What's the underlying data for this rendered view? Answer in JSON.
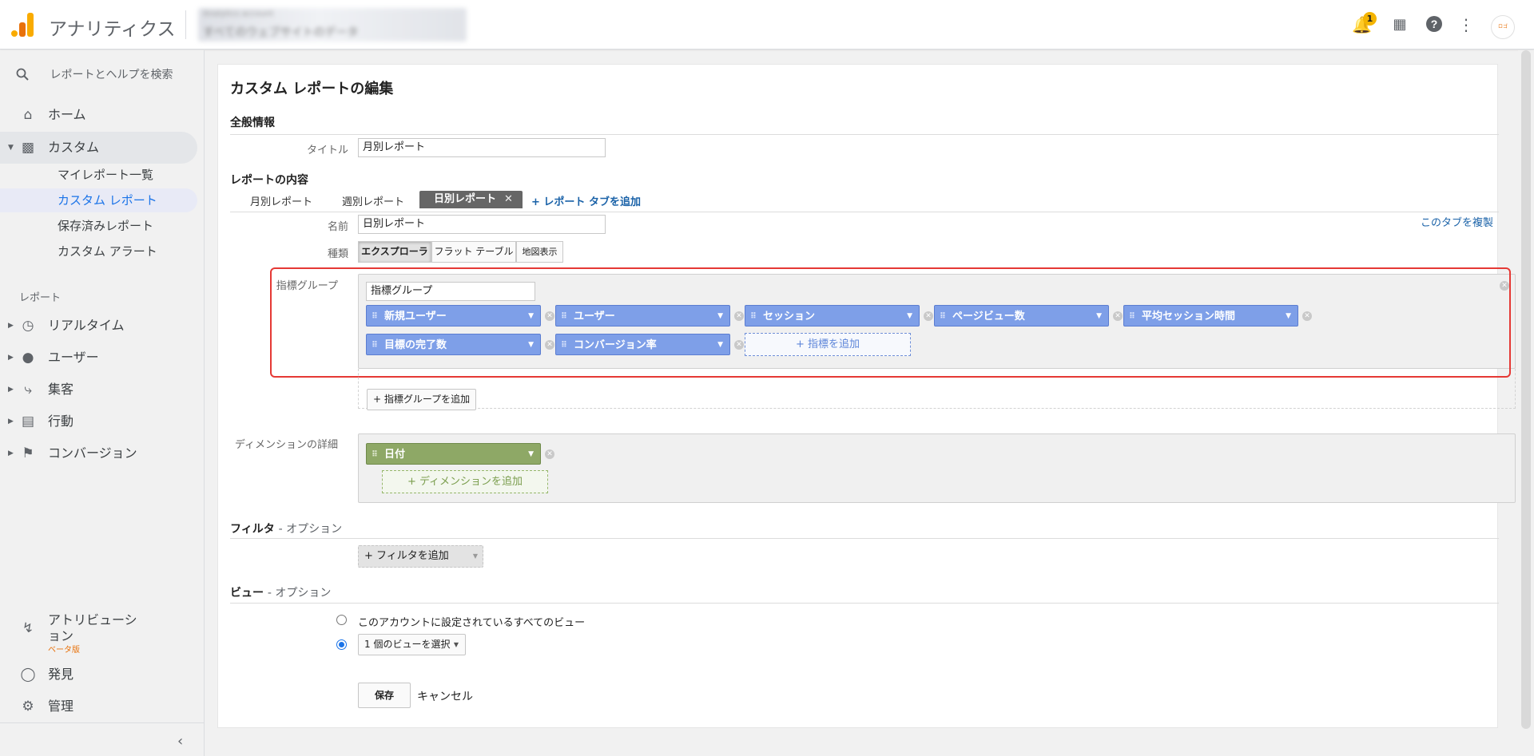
{
  "app": {
    "title": "アナリティクス",
    "account_line1": "Analytics account",
    "account_line2": "すべてのウェブサイトのデータ",
    "notif_count": "1",
    "avatar": "ロゴ"
  },
  "sidebar": {
    "search": "レポートとヘルプを検索",
    "home": "ホーム",
    "custom": "カスタム",
    "sub": [
      "マイレポート一覧",
      "カスタム レポート",
      "保存済みレポート",
      "カスタム アラート"
    ],
    "reports_label": "レポート",
    "items": [
      "リアルタイム",
      "ユーザー",
      "集客",
      "行動",
      "コンバージョン"
    ],
    "attribution": "アトリビューション",
    "beta": "ベータ版",
    "discover": "発見",
    "admin": "管理"
  },
  "page": {
    "heading": "カスタム レポートの編集",
    "general": "全般情報",
    "title_label": "タイトル",
    "title_value": "月別レポート",
    "content": "レポートの内容",
    "tabs": [
      "月別レポート",
      "週別レポート",
      "日別レポート"
    ],
    "add_tab": "+ レポート タブを追加",
    "duplicate_tab": "このタブを複製",
    "name_label": "名前",
    "name_value": "日別レポート",
    "type_label": "種類",
    "types": [
      "エクスプローラ",
      "フラット テーブル",
      "地図表示"
    ],
    "metric_group_label": "指標グループ",
    "metric_group_name": "指標グループ",
    "metrics": [
      "新規ユーザー",
      "ユーザー",
      "セッション",
      "ページビュー数",
      "平均セッション時間",
      "目標の完了数",
      "コンバージョン率"
    ],
    "add_metric": "+ 指標を追加",
    "add_metric_group": "+ 指標グループを追加",
    "dimension_label": "ディメンションの詳細",
    "dimension": "日付",
    "add_dimension": "+ ディメンションを追加",
    "filter": "フィルタ",
    "filter_opt": "- オプション",
    "add_filter": "+ フィルタを追加",
    "view": "ビュー",
    "view_opt": "- オプション",
    "view_all": "このアカウントに設定されているすべてのビュー",
    "view_select": "1 個のビューを選択",
    "save": "保存",
    "cancel": "キャンセル"
  },
  "colors": {
    "metric": "#7e9fe8",
    "dimension": "#8ea866",
    "highlight": "#e53935",
    "link": "#1a62a8"
  }
}
